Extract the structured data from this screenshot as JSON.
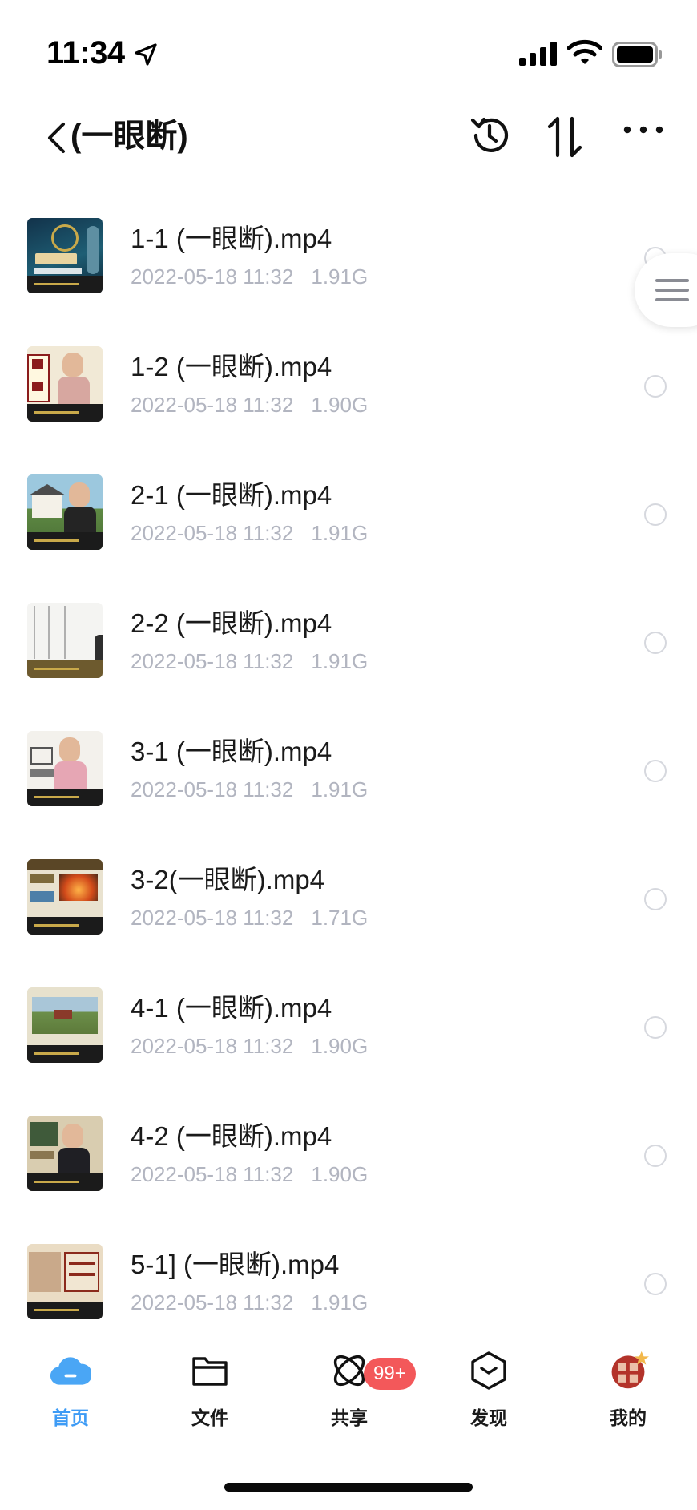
{
  "status_bar": {
    "time": "11:34"
  },
  "nav": {
    "title": "(一眼断)"
  },
  "files": [
    {
      "name": "1-1 (一眼断).mp4",
      "date": "2022-05-18 11:32",
      "size": "1.91G",
      "thumb": "title-card"
    },
    {
      "name": "1-2 (一眼断).mp4",
      "date": "2022-05-18 11:32",
      "size": "1.90G",
      "thumb": "presenter-board"
    },
    {
      "name": "2-1 (一眼断).mp4",
      "date": "2022-05-18 11:32",
      "size": "1.91G",
      "thumb": "presenter-house"
    },
    {
      "name": "2-2 (一眼断).mp4",
      "date": "2022-05-18 11:32",
      "size": "1.91G",
      "thumb": "whiteboard"
    },
    {
      "name": "3-1 (一眼断).mp4",
      "date": "2022-05-18 11:32",
      "size": "1.91G",
      "thumb": "presenter-pink"
    },
    {
      "name": "3-2(一眼断).mp4",
      "date": "2022-05-18 11:32",
      "size": "1.71G",
      "thumb": "slide-fire"
    },
    {
      "name": "4-1 (一眼断).mp4",
      "date": "2022-05-18 11:32",
      "size": "1.90G",
      "thumb": "landscape"
    },
    {
      "name": "4-2 (一眼断).mp4",
      "date": "2022-05-18 11:32",
      "size": "1.90G",
      "thumb": "presenter-dark"
    },
    {
      "name": "5-1] (一眼断).mp4",
      "date": "2022-05-18 11:32",
      "size": "1.91G",
      "thumb": "slide-text"
    }
  ],
  "tabs": [
    {
      "label": "首页",
      "icon": "cloud-icon",
      "active": true
    },
    {
      "label": "文件",
      "icon": "folder-icon",
      "active": false
    },
    {
      "label": "共享",
      "icon": "share-icon",
      "active": false
    },
    {
      "label": "发现",
      "icon": "discover-icon",
      "active": false
    },
    {
      "label": "我的",
      "icon": "avatar-icon",
      "active": false
    }
  ],
  "share_badge": "99+",
  "colors": {
    "accent": "#3d9bf5",
    "badge": "#f3585a",
    "meta_text": "#b2b5c0"
  }
}
